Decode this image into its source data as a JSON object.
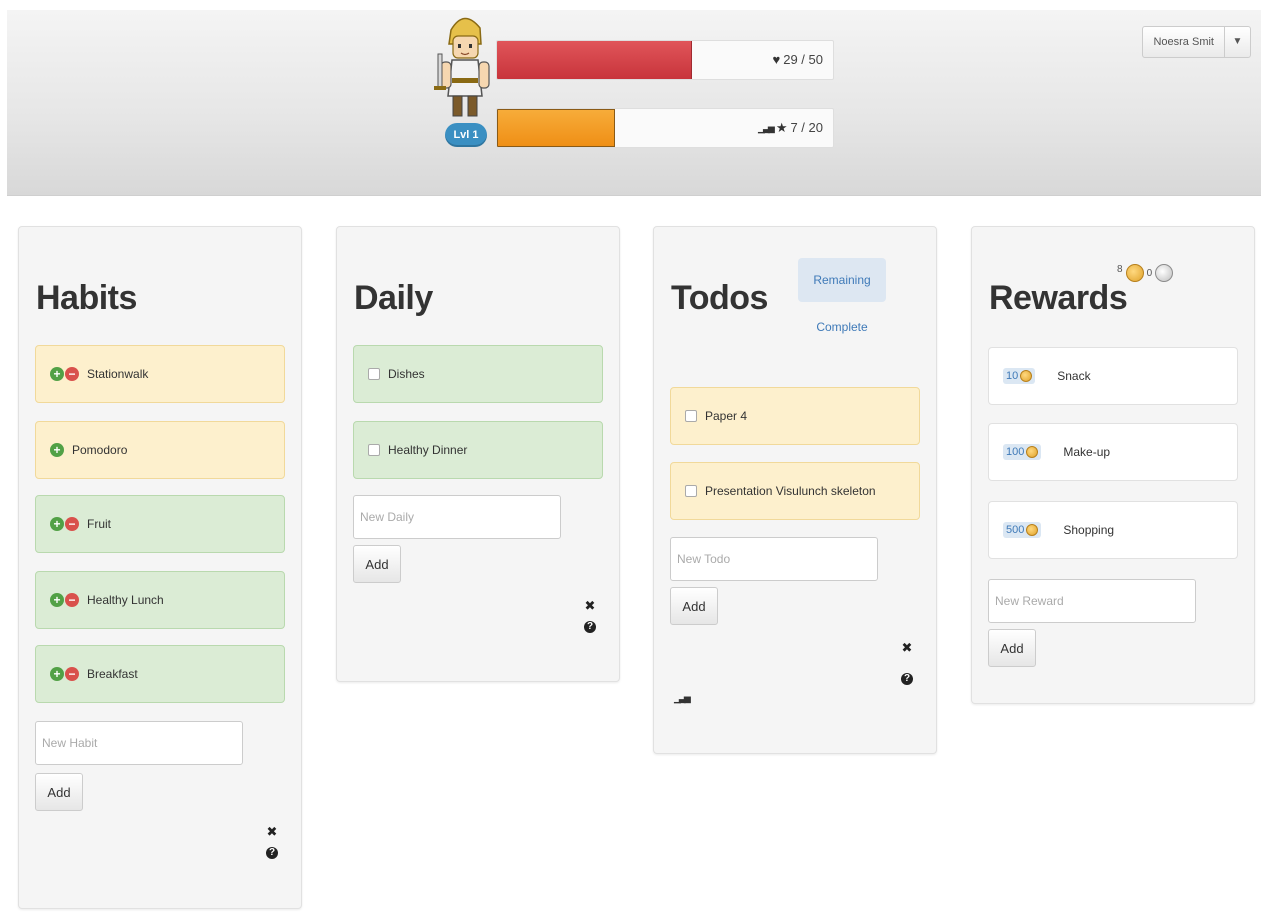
{
  "header": {
    "level": "Lvl 1",
    "hp": {
      "current": 29,
      "max": 50,
      "text": "29 / 50",
      "icon": "heart-icon",
      "color": "#d9434a"
    },
    "xp": {
      "current": 7,
      "max": 20,
      "text": "7 / 20",
      "icon": "star-icon",
      "color": "#f29b25"
    },
    "user_name": "Noesra Smit",
    "user_caret": "▼"
  },
  "habits": {
    "title": "Habits",
    "items": [
      {
        "label": "Stationwalk",
        "color": "yellow",
        "plus": true,
        "minus": true
      },
      {
        "label": "Pomodoro",
        "color": "yellow",
        "plus": true,
        "minus": false
      },
      {
        "label": "Fruit",
        "color": "green",
        "plus": true,
        "minus": true
      },
      {
        "label": "Healthy Lunch",
        "color": "green",
        "plus": true,
        "minus": true
      },
      {
        "label": "Breakfast",
        "color": "green",
        "plus": true,
        "minus": true
      }
    ],
    "new_placeholder": "New Habit",
    "add_label": "Add"
  },
  "daily": {
    "title": "Daily",
    "items": [
      {
        "label": "Dishes",
        "color": "green"
      },
      {
        "label": "Healthy Dinner",
        "color": "green"
      }
    ],
    "new_placeholder": "New Daily",
    "add_label": "Add"
  },
  "todos": {
    "title": "Todos",
    "tab_remaining": "Remaining",
    "tab_complete": "Complete",
    "items": [
      {
        "label": "Paper 4",
        "color": "yellow"
      },
      {
        "label": "Presentation Visulunch skeleton",
        "color": "yellow"
      }
    ],
    "new_placeholder": "New Todo",
    "add_label": "Add"
  },
  "rewards": {
    "title": "Rewards",
    "gold": "8",
    "silver": "0",
    "items": [
      {
        "cost": "10",
        "label": "Snack"
      },
      {
        "cost": "100",
        "label": "Make-up"
      },
      {
        "cost": "500",
        "label": "Shopping"
      }
    ],
    "new_placeholder": "New Reward",
    "add_label": "Add"
  },
  "icons": {
    "close": "✖",
    "help": "?",
    "chart": "▁▃▅"
  },
  "colors": {
    "habit_yellow": "#fdf0cd",
    "habit_green": "#dbecd5",
    "level_badge": "#3a8fc2",
    "link_blue": "#3f7ab8"
  }
}
